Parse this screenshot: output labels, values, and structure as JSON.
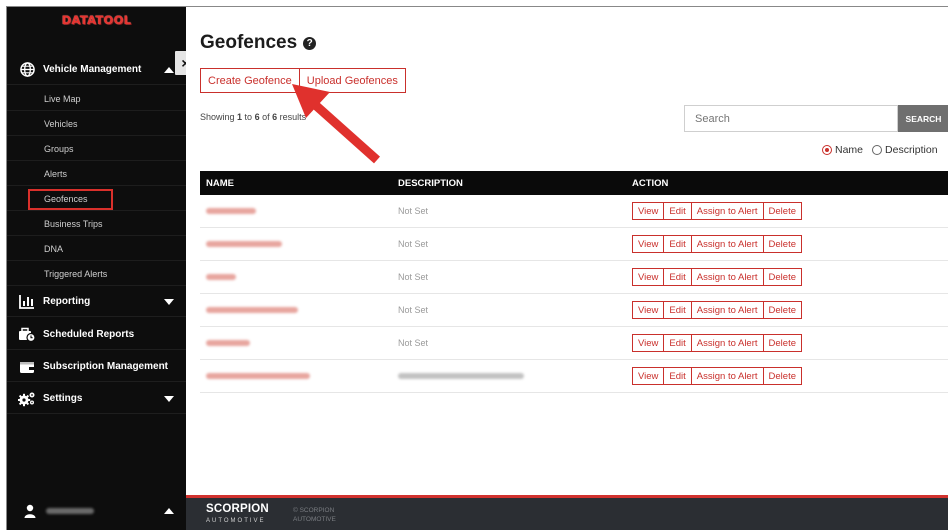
{
  "sidebar": {
    "logo": "DATATOOL",
    "vehicle_management": "Vehicle Management",
    "sub_items": [
      "Live Map",
      "Vehicles",
      "Groups",
      "Alerts",
      "Geofences",
      "Business Trips",
      "DNA",
      "Triggered Alerts"
    ],
    "reporting": "Reporting",
    "scheduled_reports": "Scheduled Reports",
    "subscription_management": "Subscription Management",
    "settings": "Settings"
  },
  "close_label": "×",
  "page": {
    "title": "Geofences",
    "help": "?",
    "create_button": "Create Geofence",
    "upload_button": "Upload Geofences",
    "showing_prefix": "Showing ",
    "showing_from": "1",
    "showing_mid1": " to ",
    "showing_to": "6",
    "showing_mid2": " of ",
    "showing_total": "6",
    "showing_suffix": " results"
  },
  "search": {
    "placeholder": "Search",
    "button": "SEARCH",
    "option_name": "Name",
    "option_description": "Description",
    "selected": "Name"
  },
  "table": {
    "headers": {
      "name": "NAME",
      "description": "DESCRIPTION",
      "action": "ACTION"
    },
    "rows": [
      {
        "description": "Not Set"
      },
      {
        "description": "Not Set"
      },
      {
        "description": "Not Set"
      },
      {
        "description": "Not Set"
      },
      {
        "description": "Not Set"
      },
      {
        "description": ""
      }
    ],
    "actions": [
      "View",
      "Edit",
      "Assign to Alert",
      "Delete"
    ]
  },
  "footer": {
    "brand": "SCORPION",
    "brand_sub": "AUTOMOTIVE",
    "copy_line1": "© SCORPION",
    "copy_line2": "AUTOMOTIVE"
  },
  "colors": {
    "accent": "#c9302c",
    "sidebar_bg": "#0d0d0d",
    "footer_bg": "#2b2e33",
    "annotation_arrow": "#e0312d"
  }
}
